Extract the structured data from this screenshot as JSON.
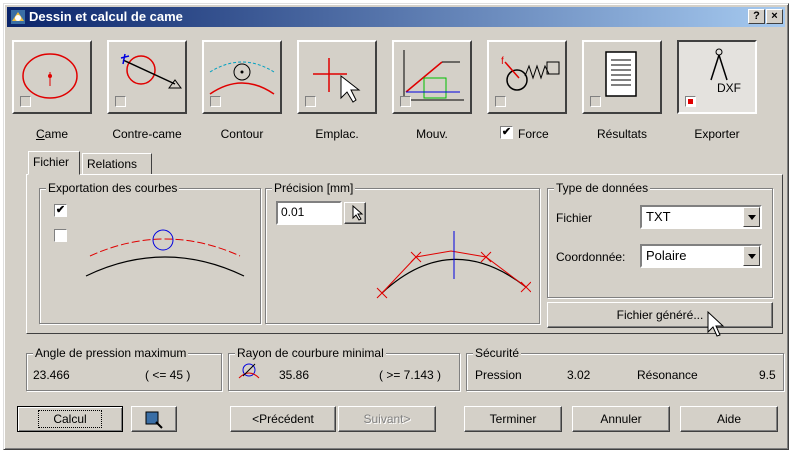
{
  "title": "Dessin et calcul de came",
  "titlebar": {
    "help": "?",
    "close": "×"
  },
  "toolbar": [
    {
      "label": "Came"
    },
    {
      "label": "Contre-came"
    },
    {
      "label": "Contour"
    },
    {
      "label": "Emplac."
    },
    {
      "label": "Mouv."
    },
    {
      "label": "Force",
      "checked": true
    },
    {
      "label": "Résultats"
    },
    {
      "label": "Exporter",
      "icon_text": "DXF"
    }
  ],
  "tabs": [
    "Fichier",
    "Relations"
  ],
  "export": {
    "title": "Exportation des courbes",
    "check1": "✔",
    "check2": ""
  },
  "precision": {
    "title": "Précision [mm]",
    "value": "0.01"
  },
  "datatype": {
    "title": "Type de données",
    "fichier_label": "Fichier",
    "fichier_value": "TXT",
    "coord_label": "Coordonnée:",
    "coord_value": "Polaire"
  },
  "generated_button": "Fichier généré...",
  "pressure": {
    "title": "Angle de pression maximum",
    "value": "23.466",
    "limit": "( <= 45 )"
  },
  "radius": {
    "title": "Rayon de courbure minimal",
    "value": "35.86",
    "limit": "( >= 7.143 )"
  },
  "security": {
    "title": "Sécurité",
    "pression_label": "Pression",
    "pression_value": "3.02",
    "resonance_label": "Résonance",
    "resonance_value": "9.5"
  },
  "buttons": {
    "calcul": "Calcul",
    "precedent": "<Précédent",
    "suivant": "Suivant>",
    "terminer": "Terminer",
    "annuler": "Annuler",
    "aide": "Aide"
  },
  "colors": {
    "title_start": "#0a246a",
    "title_end": "#a6caf0",
    "face": "#d4d0c8",
    "red": "#e00000",
    "blue": "#0000e0"
  }
}
